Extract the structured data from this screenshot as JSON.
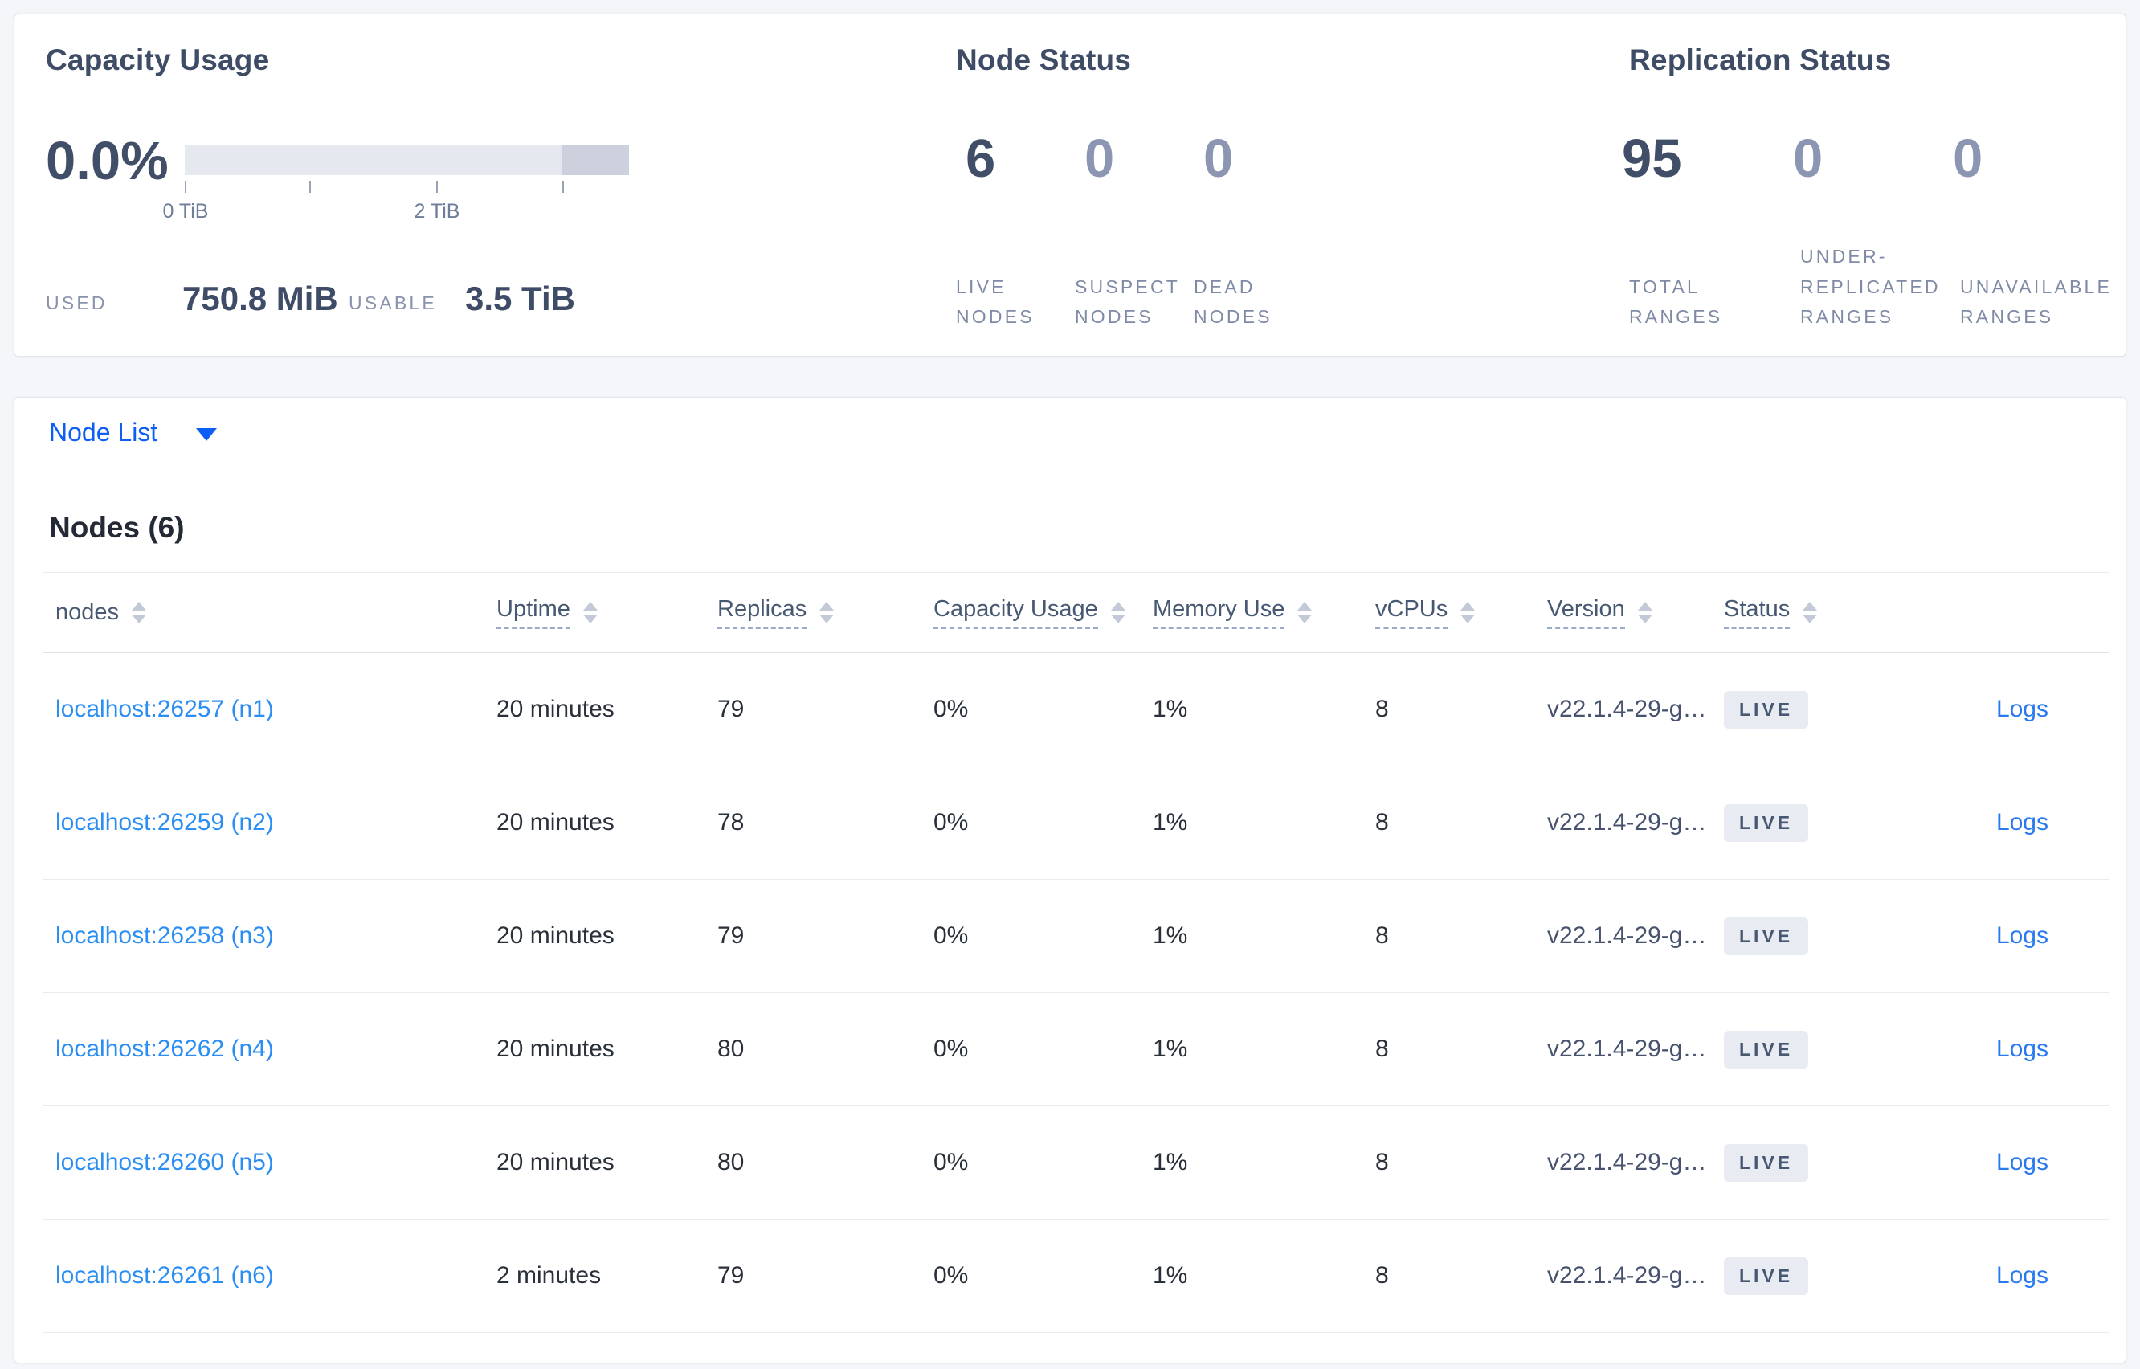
{
  "colors": {
    "page_bg": "#f4f6fa",
    "card_bg": "#ffffff",
    "heading_slate": "#3e4c66",
    "big_number_dark": "#414e68",
    "big_number_muted": "#8c96b2",
    "bar_light": "#e6e8ef",
    "bar_dark": "#cdd1dd",
    "node_list_blue": "#0d5ef5",
    "link_blue": "#2b8ef2",
    "badge_bg": "#e8ecf2",
    "badge_text": "#475872"
  },
  "summary": {
    "capacity": {
      "title": "Capacity Usage",
      "percent": "0.0%",
      "tick_label_0": "0 TiB",
      "tick_label_2": "2 TiB",
      "used_label": "USED",
      "used_value": "750.8 MiB",
      "usable_label": "USABLE",
      "usable_value": "3.5 TiB"
    },
    "node_status": {
      "title": "Node Status",
      "live_value": "6",
      "suspect_value": "0",
      "dead_value": "0",
      "live_label": [
        "LIVE",
        "NODES"
      ],
      "suspect_label": [
        "SUSPECT",
        "NODES"
      ],
      "dead_label": [
        "DEAD",
        "NODES"
      ]
    },
    "replication": {
      "title": "Replication Status",
      "total_value": "95",
      "under_replicated_value": "0",
      "unavailable_value": "0",
      "total_label": [
        "TOTAL",
        "RANGES"
      ],
      "under_replicated_label": [
        "UNDER-",
        "REPLICATED",
        "RANGES"
      ],
      "unavailable_label": [
        "UNAVAILABLE",
        "RANGES"
      ]
    }
  },
  "node_list": {
    "label": "Node List"
  },
  "table": {
    "title": "Nodes (6)",
    "columns": [
      {
        "label": "nodes"
      },
      {
        "label": "Uptime"
      },
      {
        "label": "Replicas"
      },
      {
        "label": "Capacity Usage"
      },
      {
        "label": "Memory Use"
      },
      {
        "label": "vCPUs"
      },
      {
        "label": "Version"
      },
      {
        "label": "Status"
      }
    ],
    "rows": [
      {
        "node": "localhost:26257 (n1)",
        "uptime": "20 minutes",
        "replicas": "79",
        "capacity": "0%",
        "memory": "1%",
        "vcpus": "8",
        "version": "v22.1.4-29-g…",
        "status": "LIVE",
        "logs": "Logs"
      },
      {
        "node": "localhost:26259 (n2)",
        "uptime": "20 minutes",
        "replicas": "78",
        "capacity": "0%",
        "memory": "1%",
        "vcpus": "8",
        "version": "v22.1.4-29-g…",
        "status": "LIVE",
        "logs": "Logs"
      },
      {
        "node": "localhost:26258 (n3)",
        "uptime": "20 minutes",
        "replicas": "79",
        "capacity": "0%",
        "memory": "1%",
        "vcpus": "8",
        "version": "v22.1.4-29-g…",
        "status": "LIVE",
        "logs": "Logs"
      },
      {
        "node": "localhost:26262 (n4)",
        "uptime": "20 minutes",
        "replicas": "80",
        "capacity": "0%",
        "memory": "1%",
        "vcpus": "8",
        "version": "v22.1.4-29-g…",
        "status": "LIVE",
        "logs": "Logs"
      },
      {
        "node": "localhost:26260 (n5)",
        "uptime": "20 minutes",
        "replicas": "80",
        "capacity": "0%",
        "memory": "1%",
        "vcpus": "8",
        "version": "v22.1.4-29-g…",
        "status": "LIVE",
        "logs": "Logs"
      },
      {
        "node": "localhost:26261 (n6)",
        "uptime": "2 minutes",
        "replicas": "79",
        "capacity": "0%",
        "memory": "1%",
        "vcpus": "8",
        "version": "v22.1.4-29-g…",
        "status": "LIVE",
        "logs": "Logs"
      }
    ]
  }
}
